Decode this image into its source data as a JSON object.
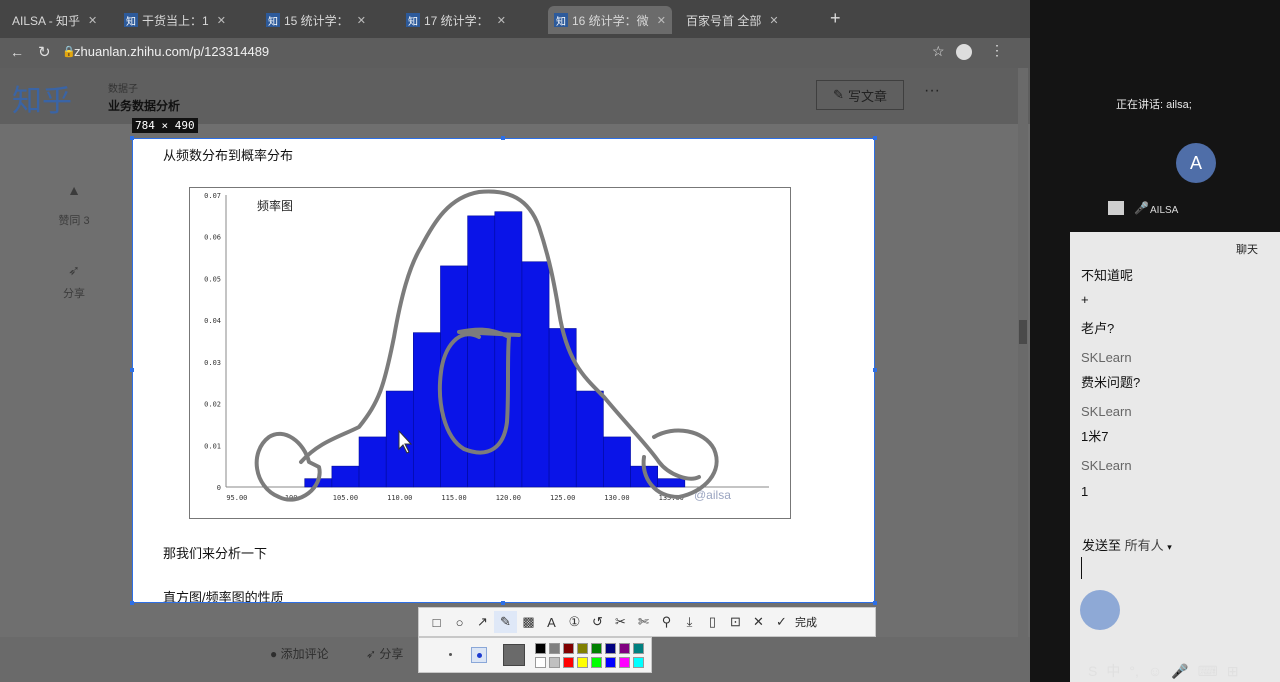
{
  "browser": {
    "tabs": [
      {
        "icon": "",
        "label": "AILSA - 知乎"
      },
      {
        "icon": "知",
        "label": "干货当上：1"
      },
      {
        "icon": "知",
        "label": "15 统计学："
      },
      {
        "icon": "知",
        "label": "17 统计学："
      },
      {
        "icon": "知",
        "label": "16 统计学：微"
      },
      {
        "icon": "",
        "label": "百家号首 全部"
      }
    ],
    "new_tab": "+",
    "url": "zhuanlan.zhihu.com/p/123314489"
  },
  "zhihu": {
    "logo": "知乎",
    "column_name": "数据子",
    "column_subtitle": "业务数据分析",
    "write_button": "写文章",
    "more": "···",
    "likes": "赞同 3",
    "share": "分享"
  },
  "capture": {
    "size_label": "784 × 490",
    "heading": "从频数分布到概率分布",
    "para1": "那我们来分析一下",
    "para2": "直方图/频率图的性质"
  },
  "chart_data": {
    "type": "bar",
    "title": "频率图",
    "watermark": "@ailsa",
    "xticks": [
      "95.00",
      "100",
      "105.00",
      "110.00",
      "115.00",
      "120.00",
      "125.00",
      "130.00",
      "135.00"
    ],
    "xtick_values": [
      95,
      100,
      105,
      110,
      115,
      120,
      125,
      130,
      135
    ],
    "yticks": [
      "0",
      "0.01",
      "0.02",
      "0.03",
      "0.04",
      "0.05",
      "0.06",
      "0.07"
    ],
    "ytick_values": [
      0,
      0.01,
      0.02,
      0.03,
      0.04,
      0.05,
      0.06,
      0.07
    ],
    "xlim": [
      94,
      144
    ],
    "ylim": [
      0,
      0.07
    ],
    "bin_width": 2.5,
    "bin_starts": [
      101.25,
      103.75,
      106.25,
      108.75,
      111.25,
      113.75,
      116.25,
      118.75,
      121.25,
      123.75,
      126.25,
      128.75,
      131.25,
      133.75
    ],
    "values": [
      0.002,
      0.005,
      0.012,
      0.023,
      0.037,
      0.053,
      0.065,
      0.066,
      0.054,
      0.038,
      0.023,
      0.012,
      0.005,
      0.002
    ],
    "bar_color": "#0a14e8"
  },
  "toolbar": {
    "tools": [
      {
        "icon": "rectangle-icon",
        "glyph": "□"
      },
      {
        "icon": "ellipse-icon",
        "glyph": "○"
      },
      {
        "icon": "arrow-icon",
        "glyph": "↗"
      },
      {
        "icon": "pen-icon",
        "glyph": "✎"
      },
      {
        "icon": "mosaic-icon",
        "glyph": "▩"
      },
      {
        "icon": "text-icon",
        "glyph": "A"
      },
      {
        "icon": "number-icon",
        "glyph": "①"
      },
      {
        "icon": "undo-icon",
        "glyph": "↺"
      },
      {
        "icon": "crop-icon",
        "glyph": "✂"
      },
      {
        "icon": "scissors-icon",
        "glyph": "✄"
      },
      {
        "icon": "pin-icon",
        "glyph": "⚲"
      },
      {
        "icon": "download-icon",
        "glyph": "⤓"
      },
      {
        "icon": "phone-icon",
        "glyph": "▯"
      },
      {
        "icon": "save-icon",
        "glyph": "⊡"
      },
      {
        "icon": "close-icon",
        "glyph": "✕"
      },
      {
        "icon": "check-icon",
        "glyph": "✓"
      }
    ],
    "done_label": "完成",
    "colors": [
      "#000000",
      "#808080",
      "#800000",
      "#808000",
      "#008000",
      "#000080",
      "#800080",
      "#008080",
      "#ffffff",
      "#c0c0c0",
      "#ff0000",
      "#ffff00",
      "#00ff00",
      "#0000ff",
      "#ff00ff",
      "#00ffff"
    ]
  },
  "page_bottom": {
    "comment": "添加评论",
    "share": "分享"
  },
  "meeting": {
    "speaking": "正在讲话: ailsa;",
    "avatar_initial": "A",
    "participant": "AILSA",
    "chat_title": "聊天",
    "messages": [
      {
        "kind": "msg",
        "text": "不知道呢"
      },
      {
        "kind": "msg",
        "text": "+"
      },
      {
        "kind": "msg",
        "text": "老卢?"
      },
      {
        "kind": "name",
        "text": "SKLearn"
      },
      {
        "kind": "msg",
        "text": "费米问题?"
      },
      {
        "kind": "name",
        "text": "SKLearn"
      },
      {
        "kind": "msg",
        "text": "1米7"
      },
      {
        "kind": "name",
        "text": "SKLearn"
      },
      {
        "kind": "msg",
        "text": "1"
      }
    ],
    "send_to_label": "发送至",
    "send_to_value": "所有人",
    "taskbar": [
      "S",
      "中",
      "°,",
      "☺",
      "🎤",
      "⌨",
      "⊞"
    ]
  }
}
